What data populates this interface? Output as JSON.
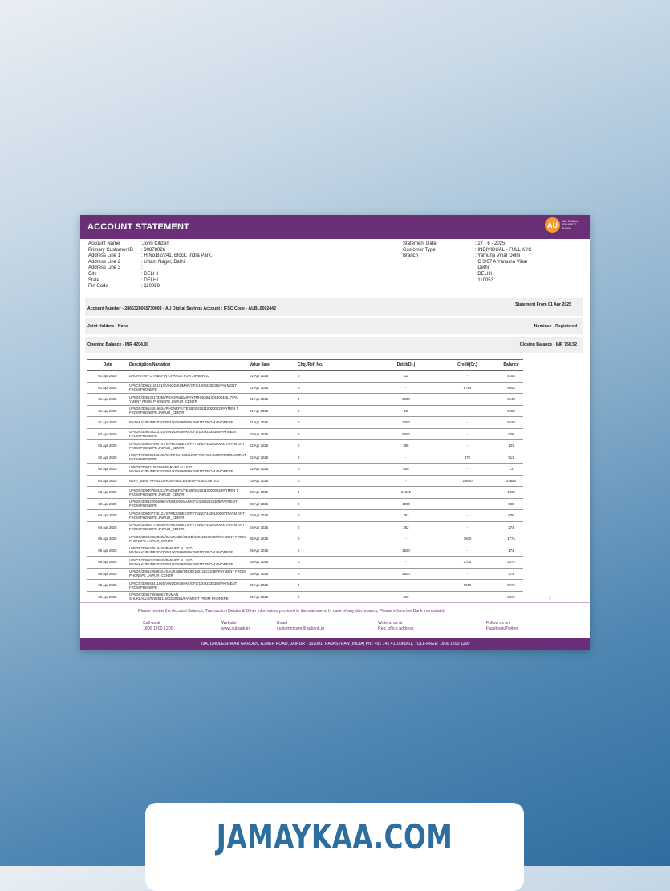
{
  "header": {
    "title": "ACCOUNT STATEMENT",
    "logo_initials": "AU",
    "logo_text": "AU SMALL FINANCE BANK"
  },
  "customer": [
    {
      "label": "Account Name",
      "value": ":John Citizen"
    },
    {
      "label": "Primary Customer ID",
      "value": ": 30878026"
    },
    {
      "label": "Address Line 1",
      "value": ": H No.B2/241, Block, Indra Park,"
    },
    {
      "label": "Address Line 2",
      "value": ": Uttam Nagar, Delhi"
    },
    {
      "label": "Address Line 3",
      "value": ":"
    },
    {
      "label": "City",
      "value": ": DELHI"
    },
    {
      "label": "State",
      "value": ": DELHI"
    },
    {
      "label": "Pin Code",
      "value": ": 110059"
    }
  ],
  "statement": {
    "date_label": "Statement Date",
    "date_value": ": 27 - 6 - 2025",
    "type_label": "Customer Type",
    "type_value": ": INDIVIDUAL - FULL KYC",
    "branch_label": "Branch",
    "branch_lines": [
      ": Yamuna Vihar Delhi",
      "  C 3/67 A,Yamuna Vihar",
      "  Delhi",
      "  DELHI",
      "  110053"
    ]
  },
  "bands": {
    "account_number": "Account Number - 2865328065730008 - AU Digital Savings Account ; IFSC Code - AUBL0002442",
    "statement_from": "Statement From 01 Apr 2025",
    "joint_holders": "Joint Holders - None",
    "nominee": "Nominee - Registered",
    "opening_balance": "Opening Balance - INR 4204.00",
    "closing_balance": "Closing Balance - INR 756.52"
  },
  "table": {
    "headers": [
      "Date",
      "Description/Narration",
      "Value date",
      "Chq./Ref. No.",
      "Debit(Dr.)",
      "Credit(Cr.)",
      "Balance"
    ],
    "rows": [
      [
        "01 Apr 2025",
        "DRCROTXN OTHBKFIN CHARGE FOR 29-MAR-23",
        "01 Apr 2025",
        "0",
        "11",
        "-",
        "4183"
      ],
      [
        "01 Apr 2025",
        "UPI/CR/309111261017/VINOD KUMAR/CFS/10092335388/PAYMENT FROM PHONEPE",
        "01 Apr 2025",
        "0",
        "-",
        "5750",
        "9943"
      ],
      [
        "01 Apr 2025",
        "UPI/DR/309136173358/PRAJANLBA/PAYTMHNDB/100190845517/PA YMENT FROM PHONEPE JAIPUR_CENTR",
        "01 Apr 2025",
        "0",
        "3000",
        "-",
        "6943"
      ],
      [
        "01 Apr 2025",
        "UPI/DR/309141816634/PHONEPE/YESB/00228110000002/PAYMEN T FROM PHONEPE JAIPUR_CENTR",
        "01 Apr 2025",
        "0",
        "15",
        "-",
        "6928"
      ],
      [
        "01 Apr 2025",
        "NAZAKAT/PUNB/2042000100158665/PAYMENT FROM PHONEPE",
        "01 Apr 2025",
        "0",
        "1400",
        "-",
        "5528"
      ],
      [
        "02 Apr 2025",
        "UPI/DR/309233113147/VINOD KUMAR/CFS/10092335388/PAYMENT FROM PHONEPE",
        "02 Apr 2025",
        "0",
        "5000",
        "-",
        "528"
      ],
      [
        "02 Apr 2025",
        "UPI/DR/309207994747/XPRESSBEES/PYTM/1074420100000TPAYM ENT FROM PHONEPE JAIPUR_CENTR",
        "02 Apr 2025",
        "0",
        "385",
        "-",
        "143"
      ],
      [
        "02 Apr 2025",
        "UPI/CR/309294468406/SUDESH JAIN/HDFC/501004456683328/PAYMENT FROM PHONEPE",
        "02 Apr 2025",
        "0",
        "-",
        "470",
        "613"
      ],
      [
        "02 Apr 2025",
        "UPI/DR/309211662566/PARVEZ ALI S O NAZAKAT/PUNB/2042000100158665/PAYMENT FROM PHONEPE",
        "02 Apr 2025",
        "0",
        "600",
        "-",
        "13"
      ],
      [
        "03 Apr 2025",
        "NEFT_SBIN: APOLLO HOSPITEL ENTERPRISE LIMITED",
        "03 Apr 2025",
        "0",
        "-",
        "23650",
        "23663"
      ],
      [
        "03 Apr 2025",
        "UPI/DR/309307884313/PHONEPE/YESB/00228110000002/PAYMEN T FROM PHONEPE JAIPUR_CENTR",
        "03 Apr 2025",
        "0",
        "21665",
        "-",
        "1998"
      ],
      [
        "03 Apr 2025",
        "UPI/DR/309322084098/VINOD KUMAR/CFS/10092335388/PAYMENT FROM PHONEPE",
        "03 Apr 2025",
        "0",
        "1000",
        "-",
        "998"
      ],
      [
        "04 Apr 2025",
        "UPI/DR/309407725121/XPRESSBEES/PYTM/1074420100000TPAYM ENT FROM PHONEPE JAIPUR_CENTR",
        "04 Apr 2025",
        "0",
        "362",
        "-",
        "636"
      ],
      [
        "04 Apr 2025",
        "UPI/DR/309407725840/XPRESSBEES/PYTM/1074420100000TPAYM ENT FROM PHONEPE JAIPUR_CENTR",
        "04 Apr 2025",
        "0",
        "362",
        "-",
        "274"
      ],
      [
        "05 Apr 2025",
        "UPI/CR/309598625623/SAURABH/HNDB/100128233486/PAYMENT FROM PHONEPE JAIPUR_CENTR",
        "05 Apr 2025",
        "0",
        "-",
        "1500",
        "1774"
      ],
      [
        "05 Apr 2025",
        "UPI/DR/309527519428/PARVEZ ALI S O NAZAKAT/PUNB/2042000100158665/PAYMENT FROM PHONEPE",
        "05 Apr 2025",
        "0",
        "1600",
        "-",
        "174"
      ],
      [
        "05 Apr 2025",
        "UPI/CR/309501035845/PARVEZ ALI S O NAZAKAT/PUNB/2042000100158665/PAYMENT FROM PHONEPE",
        "05 Apr 2025",
        "0",
        "-",
        "2700",
        "2874"
      ],
      [
        "05 Apr 2025",
        "UPI/DR/309522989324/SAURABH/HNDB/100128233486/PAYMENT FROM PHONEPE JAIPUR_CENTR",
        "05 Apr 2025",
        "0",
        "2500",
        "-",
        "374"
      ],
      [
        "05 Apr 2025",
        "UPI/CR/309564411860/VINOD KUMAR/CFS/10092335388/PAYMENT FROM PHONEPE",
        "05 Apr 2025",
        "0",
        "-",
        "9600",
        "9974"
      ],
      [
        "05 Apr 2025",
        "UPI/DR/309579846057/SUMAN SHUKLA/UJVN/225411001000651/PAYMENT FROM PHONEPE",
        "05 Apr 2025",
        "0",
        "500",
        "-",
        "9474"
      ]
    ]
  },
  "page_number": "1",
  "notice": "Please review the Account Balance, Transaction Details & Other information provided in the statement. In case of any discrepancy, Please inform the Bank immediately",
  "contacts": [
    {
      "title": "Call us at",
      "value": "1800 1200 1200"
    },
    {
      "title": "Website",
      "value": "www.aubank.in"
    },
    {
      "title": "Email",
      "value": "customercare@aubank.in"
    },
    {
      "title": "Write to us at",
      "value": "Reg. office address"
    },
    {
      "title": "Follow us on",
      "value": "Facebook/Twitter"
    }
  ],
  "footer": "19A, DHULESHWAR GARDEN, AJMER ROAD, JAIPUR - 302001, RAJASTHAN (INDIA) Ph.: +91 141 4110060/61, TOLL-FREE: 1800 1200 1200",
  "watermark": "JAMAYKAA.COM",
  "colors": {
    "accent": "#6b2f78",
    "logo": "#f39c34",
    "brand": "#2e6e9e"
  }
}
